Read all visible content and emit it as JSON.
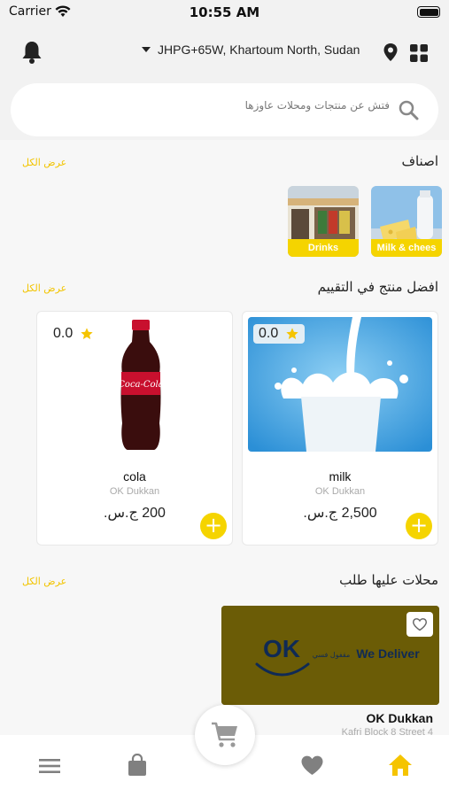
{
  "status_bar": {
    "carrier": "Carrier",
    "time": "10:55 AM"
  },
  "header": {
    "address": "JHPG+65W, Khartoum North, Sudan",
    "search_placeholder": "فتش عن منتجات ومحلات عاوزها"
  },
  "categories_section": {
    "title": "اصناف",
    "view_all": "عرض الكل",
    "items": [
      {
        "label": "Milk & chees"
      },
      {
        "label": "Drinks"
      }
    ]
  },
  "top_rated_section": {
    "title": "افضل منتج في التقييم",
    "view_all": "عرض الكل",
    "products": [
      {
        "name": "milk",
        "store": "OK Dukkan",
        "price": "2,500 ج.س.",
        "rating": "0.0"
      },
      {
        "name": "cola",
        "store": "OK Dukkan",
        "price": "200 ج.س.",
        "rating": "0.0"
      }
    ]
  },
  "stores_section": {
    "title": "محلات عليها طلب",
    "view_all": "عرض الكل",
    "stores": [
      {
        "name": "OK Dukkan",
        "address": "Kafri Block 8 Street 4",
        "logo_text": "OK",
        "logo_tagline_ar": "مقفول فسي",
        "logo_tagline_en": "We Deliver"
      }
    ]
  },
  "colors": {
    "accent": "#f5d400",
    "store_banner": "#6b5c06",
    "icon_gray": "#808080"
  },
  "icons": [
    "bell-icon",
    "location-pin-icon",
    "grid-icon",
    "search-icon",
    "star-icon",
    "plus-icon",
    "heart-outline-icon",
    "cart-icon",
    "menu-icon",
    "bag-icon",
    "heart-icon",
    "home-icon"
  ]
}
